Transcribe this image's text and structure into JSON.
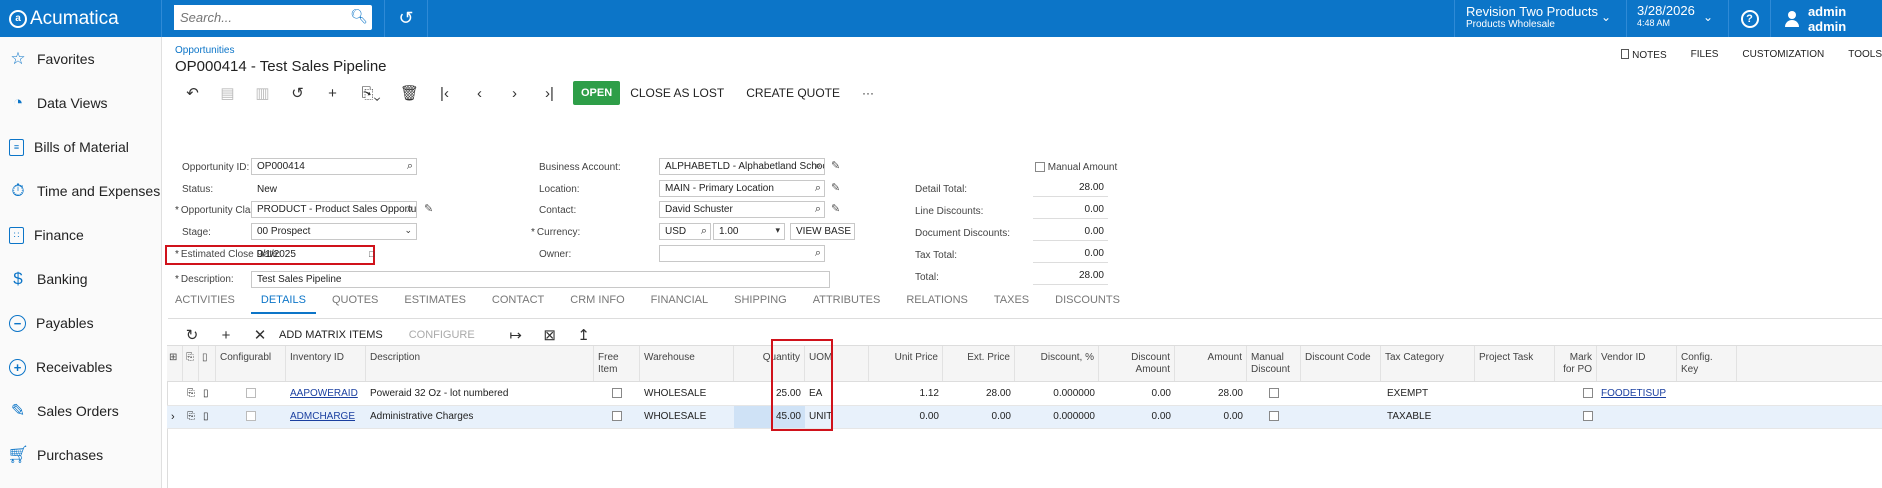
{
  "app": {
    "name": "Acumatica"
  },
  "search": {
    "placeholder": "Search..."
  },
  "branch": {
    "title": "Revision Two Products",
    "subtitle": "Products Wholesale"
  },
  "datetime": {
    "date": "3/28/2026",
    "time": "4:48 AM"
  },
  "user": {
    "name": "admin admin"
  },
  "sidebar": {
    "items": [
      {
        "label": "Favorites",
        "icon": "star-icon"
      },
      {
        "label": "Data Views",
        "icon": "chart-icon"
      },
      {
        "label": "Bills of Material",
        "icon": "document-icon"
      },
      {
        "label": "Time and Expenses",
        "icon": "stopwatch-icon"
      },
      {
        "label": "Finance",
        "icon": "calculator-icon"
      },
      {
        "label": "Banking",
        "icon": "dollar-icon"
      },
      {
        "label": "Payables",
        "icon": "minus-circle-icon"
      },
      {
        "label": "Receivables",
        "icon": "plus-circle-icon"
      },
      {
        "label": "Sales Orders",
        "icon": "pencil-icon"
      },
      {
        "label": "Purchases",
        "icon": "cart-icon"
      }
    ]
  },
  "page": {
    "breadcrumb": "Opportunities",
    "title": "OP000414 - Test Sales Pipeline",
    "links": {
      "notes": "NOTES",
      "files": "FILES",
      "customization": "CUSTOMIZATION",
      "tools": "TOOLS"
    }
  },
  "toolbar": {
    "open": "OPEN",
    "close_as_lost": "CLOSE AS LOST",
    "create_quote": "CREATE QUOTE",
    "more": "···"
  },
  "form": {
    "opportunity_id": {
      "label": "Opportunity ID:",
      "value": "OP000414"
    },
    "status": {
      "label": "Status:",
      "value": "New"
    },
    "opportunity_class": {
      "label": "Opportunity Class:",
      "value": "PRODUCT - Product Sales Opportunit"
    },
    "stage": {
      "label": "Stage:",
      "value": "00 Prospect"
    },
    "estimated_close_date": {
      "label": "Estimated Close Date:",
      "value": "9/1/2025"
    },
    "description": {
      "label": "Description:",
      "value": "Test Sales Pipeline"
    },
    "business_account": {
      "label": "Business Account:",
      "value": "ALPHABETLD - Alphabetland School"
    },
    "location": {
      "label": "Location:",
      "value": "MAIN - Primary Location"
    },
    "contact": {
      "label": "Contact:",
      "value": "David Schuster"
    },
    "currency": {
      "label": "Currency:",
      "value": "USD",
      "rate": "1.00",
      "view_base": "VIEW BASE"
    },
    "owner": {
      "label": "Owner:",
      "value": ""
    },
    "manual_amount": {
      "label": "Manual Amount"
    },
    "totals": {
      "detail_total": {
        "label": "Detail Total:",
        "value": "28.00"
      },
      "line_discounts": {
        "label": "Line Discounts:",
        "value": "0.00"
      },
      "document_discounts": {
        "label": "Document Discounts:",
        "value": "0.00"
      },
      "tax_total": {
        "label": "Tax Total:",
        "value": "0.00"
      },
      "total": {
        "label": "Total:",
        "value": "28.00"
      }
    }
  },
  "tabs": [
    "ACTIVITIES",
    "DETAILS",
    "QUOTES",
    "ESTIMATES",
    "CONTACT",
    "CRM INFO",
    "FINANCIAL",
    "SHIPPING",
    "ATTRIBUTES",
    "RELATIONS",
    "TAXES",
    "DISCOUNTS"
  ],
  "grid_toolbar": {
    "add_matrix_items": "ADD MATRIX ITEMS",
    "configure": "CONFIGURE"
  },
  "grid": {
    "columns": {
      "configurable": "Configurabl",
      "inventory_id": "Inventory ID",
      "description": "Description",
      "free_item_1": "Free",
      "free_item_2": "Item",
      "warehouse": "Warehouse",
      "quantity": "Quantity",
      "uom": "UOM",
      "unit_price": "Unit Price",
      "ext_price": "Ext. Price",
      "discount_pct": "Discount, %",
      "discount_amount_1": "Discount",
      "discount_amount_2": "Amount",
      "amount": "Amount",
      "manual_discount_1": "Manual",
      "manual_discount_2": "Discount",
      "discount_code": "Discount Code",
      "tax_category": "Tax Category",
      "project_task": "Project Task",
      "mark_for_po_1": "Mark",
      "mark_for_po_2": "for PO",
      "vendor_id": "Vendor ID",
      "config_key_1": "Config.",
      "config_key_2": "Key"
    },
    "rows": [
      {
        "inventory_id": "AAPOWERAID",
        "description": "Poweraid 32 Oz - lot numbered",
        "warehouse": "WHOLESALE",
        "quantity": "25.00",
        "uom": "EA",
        "unit_price": "1.12",
        "ext_price": "28.00",
        "discount_pct": "0.000000",
        "discount_amount": "0.00",
        "amount": "28.00",
        "tax_category": "EXEMPT",
        "vendor_id": "FOODETISUP"
      },
      {
        "inventory_id": "ADMCHARGE",
        "description": "Administrative Charges",
        "warehouse": "WHOLESALE",
        "quantity": "45.00",
        "uom": "UNIT",
        "unit_price": "0.00",
        "ext_price": "0.00",
        "discount_pct": "0.000000",
        "discount_amount": "0.00",
        "amount": "0.00",
        "tax_category": "TAXABLE",
        "vendor_id": ""
      }
    ]
  },
  "colors": {
    "brand": "#0c75c8",
    "open_button": "#2e9e48",
    "highlight": "#d0121b",
    "selected_row": "#e8f1fb"
  }
}
